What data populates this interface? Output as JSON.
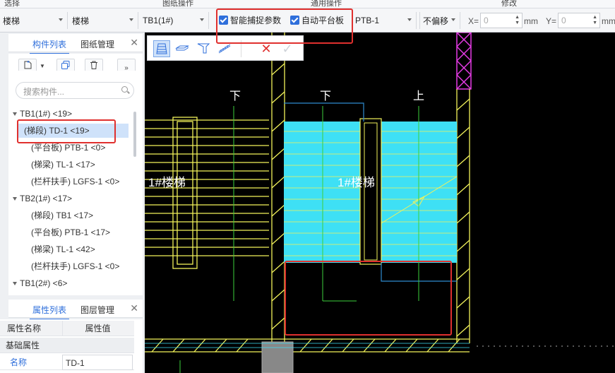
{
  "top_menu": [
    "选择",
    "图纸操作",
    "通用操作",
    "修改"
  ],
  "toolbar": {
    "floor_select": "楼梯",
    "type_select": "楼梯",
    "component_select": "TB1(1#)",
    "smart_capture_label": "智能捕捉参数",
    "smart_capture_checked": true,
    "auto_platform_label": "自动平台板",
    "auto_platform_checked": true,
    "platform_select": "PTB-1",
    "offset_select": "不偏移",
    "x_label": "X=",
    "x_value": "0",
    "y_label": "Y=",
    "y_value": "0",
    "unit": "mm"
  },
  "left_panel": {
    "tabs": [
      "构件列表",
      "图纸管理"
    ],
    "active_tab": "构件列表",
    "search_placeholder": "搜索构件...",
    "tree": [
      {
        "label": "TB1(1#) <19>",
        "level": 0
      },
      {
        "label": "(梯段) TD-1 <19>",
        "level": 1,
        "selected": true
      },
      {
        "label": "(平台板) PTB-1 <0>",
        "level": 1
      },
      {
        "label": "(梯梁) TL-1 <17>",
        "level": 1
      },
      {
        "label": "(栏杆扶手) LGFS-1 <0>",
        "level": 1
      },
      {
        "label": "TB2(1#) <17>",
        "level": 0
      },
      {
        "label": "(梯段) TB1 <17>",
        "level": 1
      },
      {
        "label": "(平台板) PTB-1 <17>",
        "level": 1
      },
      {
        "label": "(梯梁) TL-1 <42>",
        "level": 1
      },
      {
        "label": "(栏杆扶手) LGFS-1 <0>",
        "level": 1
      },
      {
        "label": "TB1(2#) <6>",
        "level": 0
      }
    ]
  },
  "property_panel": {
    "tabs": [
      "属性列表",
      "图层管理"
    ],
    "active_tab": "属性列表",
    "header": [
      "属性名称",
      "属性值"
    ],
    "group": "基础属性",
    "rows": [
      {
        "name": "名称",
        "value": "TD-1"
      }
    ]
  },
  "canvas": {
    "labels_down": [
      "下",
      "下"
    ],
    "label_up": "上",
    "stair_label_left": "1#楼梯",
    "stair_label_center": "1#楼梯"
  },
  "colors": {
    "accent": "#2f6fdb",
    "highlight_red": "#e0302e",
    "stair_fill": "#3ee0f5",
    "cad_yellow": "#f2f25a",
    "cad_green": "#3ccf3c",
    "cad_magenta": "#e53be5"
  }
}
